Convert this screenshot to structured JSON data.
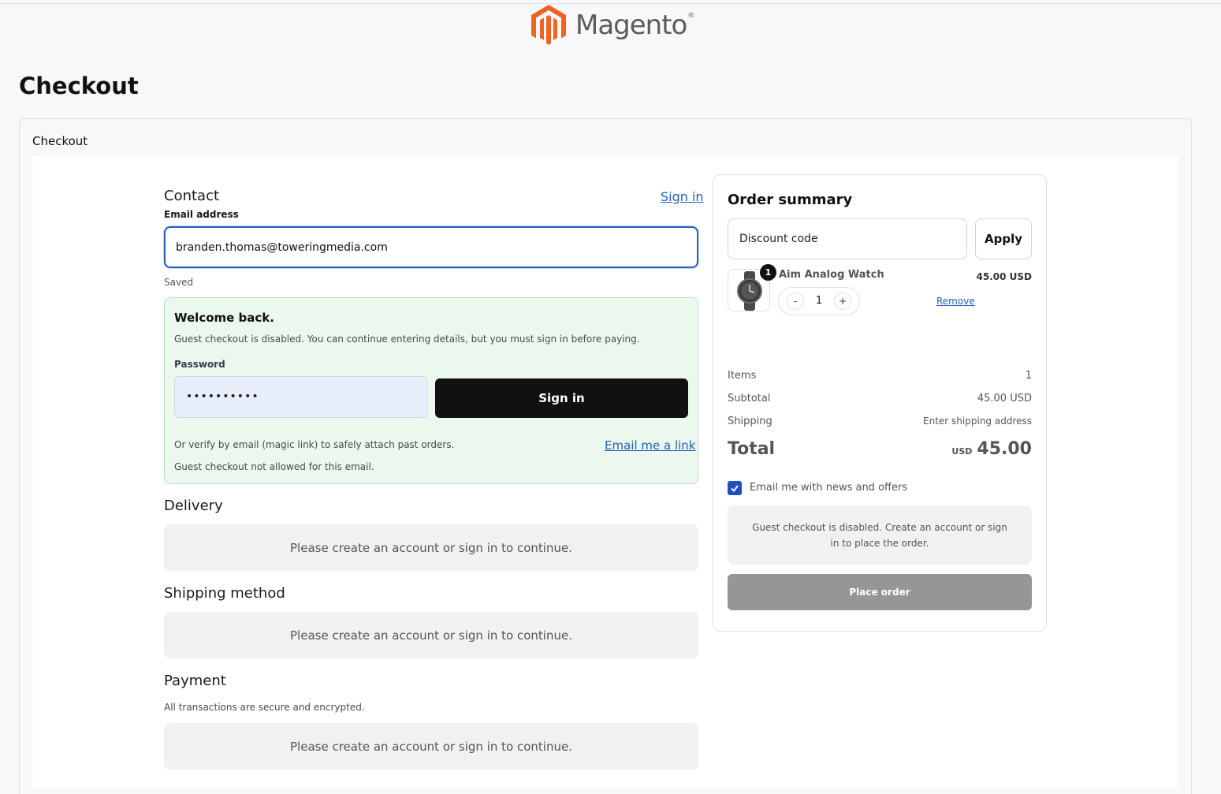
{
  "brand": {
    "name": "Magento",
    "reg": "®",
    "color": "#f26322"
  },
  "page": {
    "title": "Checkout",
    "panel_label": "Checkout"
  },
  "contact": {
    "title": "Contact",
    "signin_link": "Sign in",
    "email_label": "Email address",
    "email_value": "branden.thomas@toweringmedia.com",
    "saved_text": "Saved"
  },
  "welcome": {
    "title": "Welcome back.",
    "message": "Guest checkout is disabled. You can continue entering details, but you must sign in before paying.",
    "password_label": "Password",
    "password_masked": "••••••••••",
    "signin_button": "Sign in",
    "magic_text": "Or verify by email (magic link) to safely attach past orders.",
    "magic_link": "Email me a link",
    "guest_note": "Guest checkout not allowed for this email."
  },
  "delivery": {
    "title": "Delivery",
    "notice": "Please create an account or sign in to continue."
  },
  "shipping_method": {
    "title": "Shipping method",
    "notice": "Please create an account or sign in to continue."
  },
  "payment": {
    "title": "Payment",
    "subtitle": "All transactions are secure and encrypted.",
    "notice": "Please create an account or sign in to continue."
  },
  "summary": {
    "title": "Order summary",
    "discount_placeholder": "Discount code",
    "apply_button": "Apply",
    "item": {
      "badge": "1",
      "name": "Aim Analog Watch",
      "price": "45.00 USD",
      "minus": "-",
      "quantity": "1",
      "plus": "+",
      "remove": "Remove"
    },
    "rows": {
      "items_label": "Items",
      "items_value": "1",
      "subtotal_label": "Subtotal",
      "subtotal_value": "45.00 USD",
      "shipping_label": "Shipping",
      "shipping_value": "Enter shipping address"
    },
    "total": {
      "label": "Total",
      "currency": "USD",
      "amount": "45.00"
    },
    "newsletter_label": "Email me with news and offers",
    "newsletter_checked": true,
    "guest_disabled": "Guest checkout is disabled. Create an account or sign in to place the order.",
    "place_order": "Place order"
  },
  "colors": {
    "accent": "#1f5fbf",
    "checkbox": "#1f4fbf",
    "success_bg": "#ecf8ee",
    "disabled_button": "#969696"
  }
}
